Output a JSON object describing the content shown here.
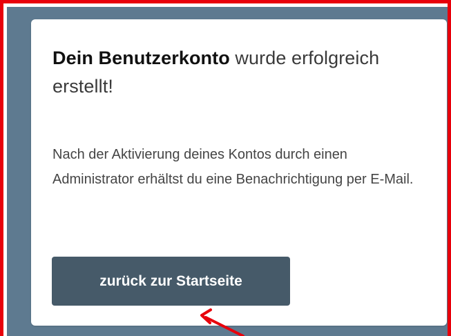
{
  "card": {
    "headline_bold": "Dein Benutzerkonto",
    "headline_rest": " wurde erfolgreich erstellt!",
    "message": "Nach der Aktivierung deines Kontos durch einen Administrator erhältst du eine Benachrichtigung per E-Mail.",
    "back_button_label": "zurück zur Startseite"
  },
  "colors": {
    "highlight_frame": "#e8000b",
    "backdrop": "#5e7a90",
    "card_background": "#ffffff",
    "button_background": "#465a69",
    "button_text": "#ffffff",
    "annotation_arrow": "#e8000b"
  },
  "icons": {
    "annotation": "annotation-arrow-icon"
  }
}
